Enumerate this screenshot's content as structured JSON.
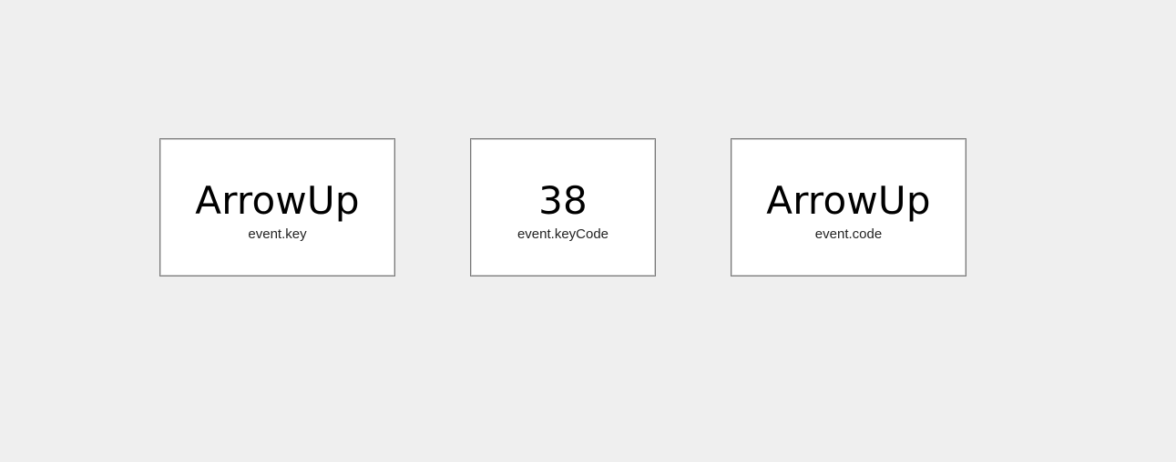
{
  "cards": [
    {
      "value": "ArrowUp",
      "label": "event.key"
    },
    {
      "value": "38",
      "label": "event.keyCode"
    },
    {
      "value": "ArrowUp",
      "label": "event.code"
    }
  ],
  "colors": {
    "background": "#efefef",
    "card_background": "#ffffff",
    "card_border": "#777777",
    "value_text": "#000000",
    "label_text": "#222222"
  }
}
